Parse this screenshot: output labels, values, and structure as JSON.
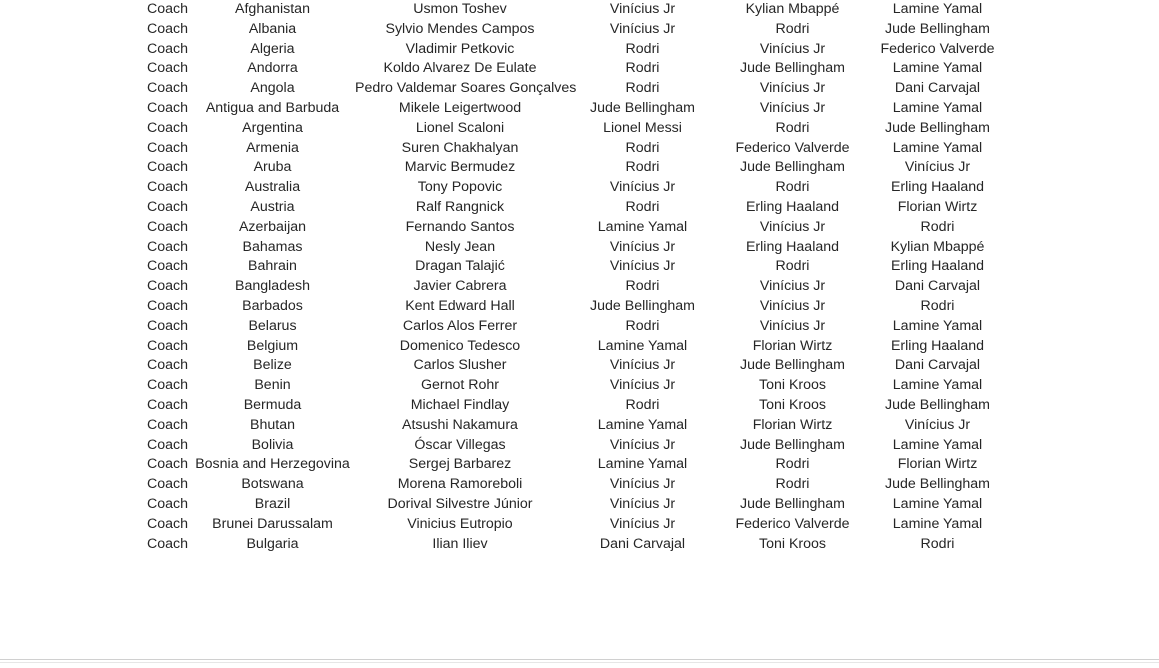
{
  "table": {
    "role_label": "Coach",
    "columns": [
      "role",
      "country",
      "coach_name",
      "player_1",
      "player_2",
      "player_3"
    ],
    "rows": [
      [
        "Coach",
        "Afghanistan",
        "Usmon Toshev",
        "Vinícius Jr",
        "Kylian Mbappé",
        "Lamine Yamal"
      ],
      [
        "Coach",
        "Albania",
        "Sylvio Mendes Campos",
        "Vinícius Jr",
        "Rodri",
        "Jude Bellingham"
      ],
      [
        "Coach",
        "Algeria",
        "Vladimir Petkovic",
        "Rodri",
        "Vinícius Jr",
        "Federico Valverde"
      ],
      [
        "Coach",
        "Andorra",
        "Koldo Alvarez De Eulate",
        "Rodri",
        "Jude Bellingham",
        "Lamine Yamal"
      ],
      [
        "Coach",
        "Angola",
        "Pedro Valdemar Soares Gonçalves",
        "Rodri",
        "Vinícius Jr",
        "Dani Carvajal"
      ],
      [
        "Coach",
        "Antigua and Barbuda",
        "Mikele Leigertwood",
        "Jude Bellingham",
        "Vinícius Jr",
        "Lamine Yamal"
      ],
      [
        "Coach",
        "Argentina",
        "Lionel Scaloni",
        "Lionel Messi",
        "Rodri",
        "Jude Bellingham"
      ],
      [
        "Coach",
        "Armenia",
        "Suren Chakhalyan",
        "Rodri",
        "Federico Valverde",
        "Lamine Yamal"
      ],
      [
        "Coach",
        "Aruba",
        "Marvic Bermudez",
        "Rodri",
        "Jude Bellingham",
        "Vinícius Jr"
      ],
      [
        "Coach",
        "Australia",
        "Tony Popovic",
        "Vinícius Jr",
        "Rodri",
        "Erling Haaland"
      ],
      [
        "Coach",
        "Austria",
        "Ralf Rangnick",
        "Rodri",
        "Erling Haaland",
        "Florian Wirtz"
      ],
      [
        "Coach",
        "Azerbaijan",
        "Fernando Santos",
        "Lamine Yamal",
        "Vinícius Jr",
        "Rodri"
      ],
      [
        "Coach",
        "Bahamas",
        "Nesly Jean",
        "Vinícius Jr",
        "Erling Haaland",
        "Kylian Mbappé"
      ],
      [
        "Coach",
        "Bahrain",
        "Dragan Talajić",
        "Vinícius Jr",
        "Rodri",
        "Erling Haaland"
      ],
      [
        "Coach",
        "Bangladesh",
        "Javier Cabrera",
        "Rodri",
        "Vinícius Jr",
        "Dani Carvajal"
      ],
      [
        "Coach",
        "Barbados",
        "Kent Edward Hall",
        "Jude Bellingham",
        "Vinícius Jr",
        "Rodri"
      ],
      [
        "Coach",
        "Belarus",
        "Carlos Alos Ferrer",
        "Rodri",
        "Vinícius Jr",
        "Lamine Yamal"
      ],
      [
        "Coach",
        "Belgium",
        "Domenico Tedesco",
        "Lamine Yamal",
        "Florian Wirtz",
        "Erling Haaland"
      ],
      [
        "Coach",
        "Belize",
        "Carlos Slusher",
        "Vinícius Jr",
        "Jude Bellingham",
        "Dani Carvajal"
      ],
      [
        "Coach",
        "Benin",
        "Gernot Rohr",
        "Vinícius Jr",
        "Toni Kroos",
        "Lamine Yamal"
      ],
      [
        "Coach",
        "Bermuda",
        "Michael Findlay",
        "Rodri",
        "Toni Kroos",
        "Jude Bellingham"
      ],
      [
        "Coach",
        "Bhutan",
        "Atsushi Nakamura",
        "Lamine Yamal",
        "Florian Wirtz",
        "Vinícius Jr"
      ],
      [
        "Coach",
        "Bolivia",
        "Óscar Villegas",
        "Vinícius Jr",
        "Jude Bellingham",
        "Lamine Yamal"
      ],
      [
        "Coach",
        "Bosnia and Herzegovina",
        "Sergej Barbarez",
        "Lamine Yamal",
        "Rodri",
        "Florian Wirtz"
      ],
      [
        "Coach",
        "Botswana",
        "Morena Ramoreboli",
        "Vinícius Jr",
        "Rodri",
        "Jude Bellingham"
      ],
      [
        "Coach",
        "Brazil",
        "Dorival Silvestre Júnior",
        "Vinícius Jr",
        "Jude Bellingham",
        "Lamine Yamal"
      ],
      [
        "Coach",
        "Brunei Darussalam",
        "Vinicius Eutropio",
        "Vinícius Jr",
        "Federico Valverde",
        "Lamine Yamal"
      ],
      [
        "Coach",
        "Bulgaria",
        "Ilian Iliev",
        "Dani Carvajal",
        "Toni Kroos",
        "Rodri"
      ]
    ]
  },
  "colors": {
    "text": "#262626",
    "background": "#ffffff",
    "rule": "#d0d0d0"
  }
}
